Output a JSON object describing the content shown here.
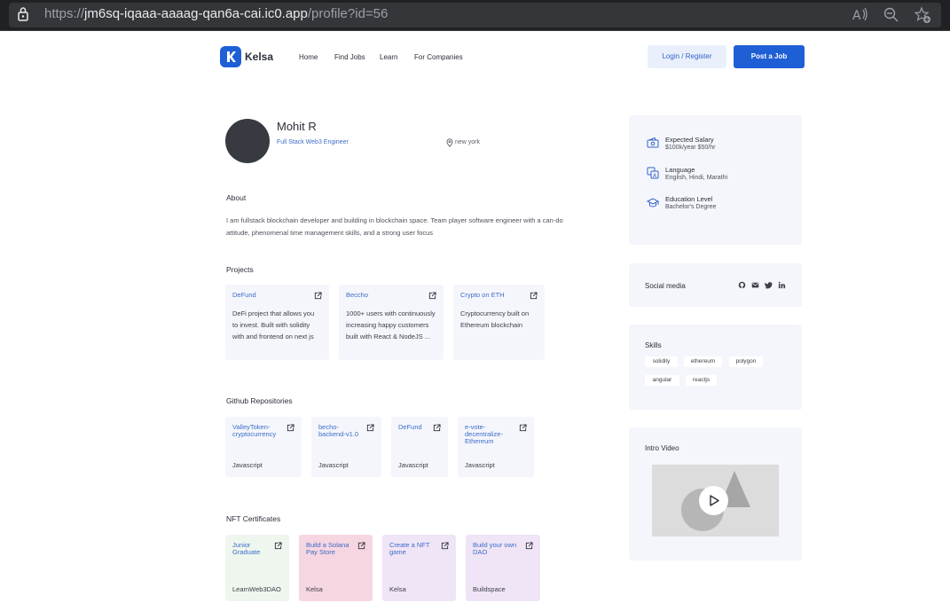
{
  "browser": {
    "url_scheme": "https://",
    "url_host": "jm6sq-iqaaa-aaaag-qan6a-cai.ic0.app",
    "url_path": "/profile?id=56"
  },
  "nav": {
    "brand": "Kelsa",
    "links": [
      "Home",
      "Find Jobs",
      "Learn",
      "For Companies"
    ],
    "login_label": "Login / Register",
    "post_label": "Post a Job"
  },
  "profile": {
    "name": "Mohit R",
    "role": "Full Stack Web3 Engineer",
    "location": "new york"
  },
  "about": {
    "title": "About",
    "text": "I am fullstack blockchain developer and building in blockchain space. Team player software engineer with a can-do attitude, phenomenal time management skills, and a strong user focus"
  },
  "projects": {
    "title": "Projects",
    "items": [
      {
        "title": "DeFund",
        "desc": [
          "DeFi project that allows you",
          "to invest. Built with solidity",
          "with and frontend on next js"
        ]
      },
      {
        "title": "Beccho",
        "desc": [
          "1000+ users with continuously",
          "increasing happy customers",
          "built with React & NodeJS ..."
        ]
      },
      {
        "title": "Crypto on ETH",
        "desc": [
          "Cryptocurrency built on",
          "Ethereum blockchain"
        ]
      }
    ]
  },
  "repos": {
    "title": "Github Repositories",
    "items": [
      {
        "title": [
          "ValleyToken-",
          "cryptocurrency"
        ],
        "lang": "Javascript"
      },
      {
        "title": [
          "becho-",
          "backend-v1.0"
        ],
        "lang": "Javascript"
      },
      {
        "title": [
          "DeFund"
        ],
        "lang": "Javascript"
      },
      {
        "title": [
          "e-vote-",
          "decentralize-",
          "Ethereum"
        ],
        "lang": "Javascript"
      }
    ]
  },
  "nft": {
    "title": "NFT Certificates",
    "items": [
      {
        "title": [
          "Junior",
          "Graduate"
        ],
        "issuer": "LearnWeb3DAO",
        "bg": "#eef6ee"
      },
      {
        "title": [
          "Build a Solana",
          "Pay Store"
        ],
        "issuer": "Kelsa",
        "bg": "#f6d6e1"
      },
      {
        "title": [
          "Create a NFT",
          "game"
        ],
        "issuer": "Kelsa",
        "bg": "#efe5f6"
      },
      {
        "title": [
          "Build your own",
          "DAO"
        ],
        "issuer": "Buildspace",
        "bg": "#efe5f6"
      }
    ]
  },
  "sidebar": {
    "salary_label": "Expected Salary",
    "salary_value": "$100k/year $50/hr",
    "language_label": "Language",
    "language_value": "English, Hindi, Marathi",
    "education_label": "Education Level",
    "education_value": "Bachelor's Degree",
    "social_title": "Social media",
    "skills_title": "Skills",
    "skills": [
      "solidity",
      "ethereum",
      "polygon",
      "angular",
      "reactjs"
    ],
    "video_title": "Intro Video"
  },
  "colors": {
    "accent": "#1f5fd6",
    "link": "#3f6cc9",
    "card_bg": "#f4f6fb"
  }
}
